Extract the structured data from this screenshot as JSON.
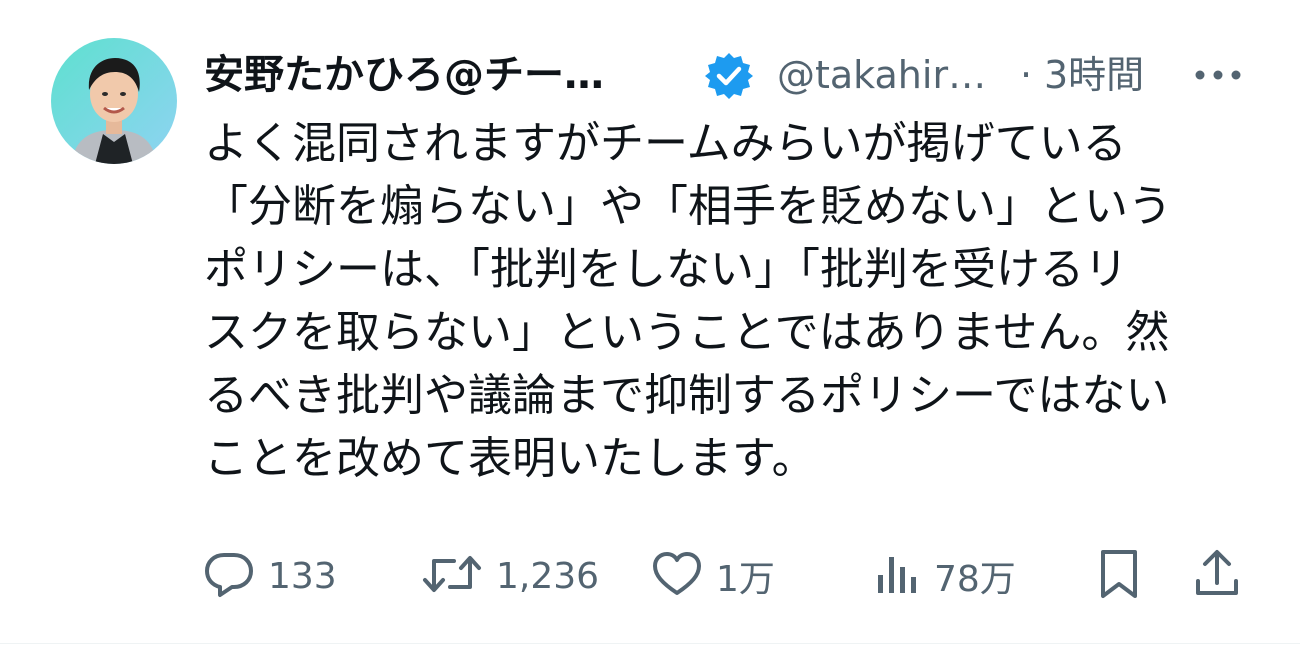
{
  "tweet": {
    "author": {
      "display_name": "安野たかひろ@チー…",
      "handle": "@takahir…",
      "verified": true
    },
    "separator": "·",
    "time": "3時間",
    "text": "よく混同されますがチームみらいが掲げている\n「分断を煽らない」や「相手を貶めない」という\nポリシーは、「批判をしない」「批判を受けるリ\nスクを取らない」ということではありません。然\nるべき批判や議論まで抑制するポリシーではない\nことを改めて表明いたします。",
    "actions": {
      "replies": "133",
      "retweets": "1,236",
      "likes": "1万",
      "views": "78万"
    },
    "icons": [
      "verified-badge-icon",
      "more-icon",
      "reply-icon",
      "retweet-icon",
      "like-icon",
      "views-icon",
      "bookmark-icon",
      "share-icon"
    ],
    "colors": {
      "text": "#0f1419",
      "secondary": "#536471",
      "verified": "#1d9bf0",
      "background": "#ffffff"
    }
  }
}
